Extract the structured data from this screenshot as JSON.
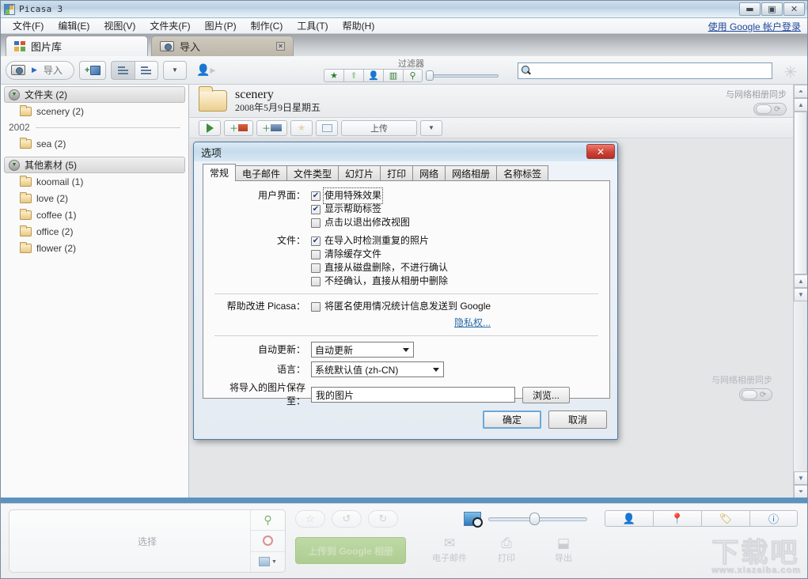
{
  "window": {
    "title": "Picasa 3",
    "controls": {
      "minimize": "—",
      "maximize": "❐",
      "close": "✕"
    }
  },
  "menubar": {
    "items": [
      {
        "label": "文件(F)"
      },
      {
        "label": "编辑(E)"
      },
      {
        "label": "视图(V)"
      },
      {
        "label": "文件夹(F)"
      },
      {
        "label": "图片(P)"
      },
      {
        "label": "制作(C)"
      },
      {
        "label": "工具(T)"
      },
      {
        "label": "帮助(H)"
      }
    ],
    "signin_link": "使用 Google 帐户登录"
  },
  "tabs": [
    {
      "label": "图片库",
      "icon": "library-icon",
      "active": true
    },
    {
      "label": "导入",
      "icon": "camera-icon",
      "active": false,
      "closable": true
    }
  ],
  "toolbar": {
    "import_label": "导入",
    "add_folder_label": "+",
    "filter": {
      "label": "过滤器",
      "buttons": [
        "star-icon",
        "up-arrow-icon",
        "person-icon",
        "film-icon",
        "pin-icon"
      ],
      "slider_value": 0
    },
    "search": {
      "value": "",
      "placeholder": "",
      "icon": "search-icon"
    },
    "spinner": "loading-spinner-icon"
  },
  "sidebar": {
    "groups": [
      {
        "header": "文件夹 (2)",
        "items": [
          {
            "label": "scenery (2)"
          }
        ],
        "year_divider": "2002",
        "items_after": [
          {
            "label": "sea (2)"
          }
        ]
      },
      {
        "header": "其他素材 (5)",
        "items": [
          {
            "label": "koomail (1)"
          },
          {
            "label": "love (2)"
          },
          {
            "label": "coffee (1)"
          },
          {
            "label": "office (2)"
          },
          {
            "label": "flower (2)"
          }
        ]
      }
    ]
  },
  "content": {
    "folder_title": "scenery",
    "folder_date": "2008年5月9日星期五",
    "sync_label": "与网络相册同步",
    "sync_label_2": "与网络相册同步",
    "toolbar_buttons": [
      {
        "name": "play-slideshow",
        "label": ""
      },
      {
        "name": "add-to-album",
        "label": ""
      },
      {
        "name": "add-to-movie",
        "label": ""
      },
      {
        "name": "star-rate",
        "label": ""
      },
      {
        "name": "fullscreen",
        "label": ""
      },
      {
        "name": "upload",
        "label": "上传"
      },
      {
        "name": "more",
        "label": ""
      }
    ]
  },
  "dialog": {
    "title": "选项",
    "close_label": "✕",
    "tabs": [
      {
        "label": "常规",
        "active": true
      },
      {
        "label": "电子邮件",
        "active": false
      },
      {
        "label": "文件类型",
        "active": false
      },
      {
        "label": "幻灯片",
        "active": false
      },
      {
        "label": "打印",
        "active": false
      },
      {
        "label": "网络",
        "active": false
      },
      {
        "label": "网络相册",
        "active": false
      },
      {
        "label": "名称标签",
        "active": false
      }
    ],
    "sections": {
      "ui": {
        "label": "用户界面：",
        "options": [
          {
            "label": "使用特殊效果",
            "checked": true,
            "focused": true
          },
          {
            "label": "显示帮助标签",
            "checked": true,
            "focused": false
          },
          {
            "label": "点击以退出修改视图",
            "checked": false,
            "focused": false
          }
        ]
      },
      "files": {
        "label": "文件：",
        "options": [
          {
            "label": "在导入时检测重复的照片",
            "checked": true
          },
          {
            "label": "清除缓存文件",
            "checked": false
          },
          {
            "label": "直接从磁盘删除，不进行确认",
            "checked": false
          },
          {
            "label": "不经确认，直接从相册中删除",
            "checked": false
          }
        ]
      },
      "improve": {
        "label": "帮助改进 Picasa：",
        "options": [
          {
            "label": "将匿名使用情况统计信息发送到 Google",
            "checked": false
          }
        ],
        "privacy_link": "隐私权..."
      },
      "autoupdate": {
        "label": "自动更新：",
        "value": "自动更新"
      },
      "language": {
        "label": "语言：",
        "value": "系统默认值 (zh-CN)"
      },
      "savepath": {
        "label": "将导入的图片保存至：",
        "value": "我的图片",
        "browse_label": "浏览..."
      }
    },
    "buttons": {
      "ok": "确定",
      "cancel": "取消"
    }
  },
  "bottom": {
    "tray_placeholder": "选择",
    "tray_side_icons": [
      "pin-green-icon",
      "circle-red-icon",
      "book-blue-icon"
    ],
    "action_icons": [
      "star-icon",
      "rotate-left-icon",
      "rotate-right-icon"
    ],
    "upload_button": "上传到 Google 相册",
    "items": [
      {
        "label": "电子邮件",
        "icon": "mail-icon"
      },
      {
        "label": "打印",
        "icon": "printer-icon"
      },
      {
        "label": "导出",
        "icon": "export-icon"
      }
    ],
    "zoom": {
      "icon": "zoom-photo-icon",
      "value": 45
    },
    "right_buttons": [
      "person-icon",
      "place-pin-icon",
      "tag-icon",
      "info-icon"
    ]
  },
  "watermark": {
    "text": "下载吧",
    "url": "www.xiazaiba.com"
  },
  "colors": {
    "accent": "#5b93c0",
    "dialog_border": "#4e7ca8",
    "close_red": "#cf4436",
    "link_blue": "#2a6aa8",
    "green": "#3a8f35"
  }
}
